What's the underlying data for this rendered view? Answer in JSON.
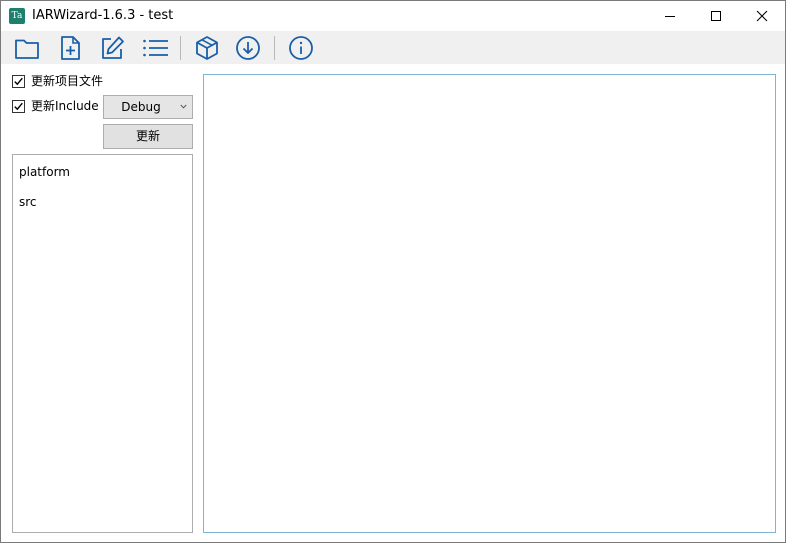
{
  "window": {
    "app_icon_text": "Ta",
    "title": "IARWizard-1.6.3 - test"
  },
  "toolbar": {
    "buttons": [
      {
        "name": "open-folder",
        "icon": "folder-icon"
      },
      {
        "name": "new-file",
        "icon": "file-plus-icon"
      },
      {
        "name": "edit",
        "icon": "edit-icon"
      },
      {
        "name": "list",
        "icon": "list-icon"
      },
      {
        "name": "package",
        "icon": "box-icon"
      },
      {
        "name": "download",
        "icon": "download-circle-icon"
      },
      {
        "name": "about",
        "icon": "info-icon"
      }
    ],
    "icon_color": "#1a5fa8"
  },
  "options": {
    "update_project_label": "更新项目文件",
    "update_project_checked": true,
    "update_include_label": "更新Include",
    "update_include_checked": true
  },
  "config_select": {
    "value": "Debug"
  },
  "update_button": {
    "label": "更新"
  },
  "tree": {
    "items": [
      "platform",
      "src"
    ]
  },
  "colors": {
    "content_border": "#7eb4d4",
    "toolbar_bg": "#f0f0f0"
  }
}
